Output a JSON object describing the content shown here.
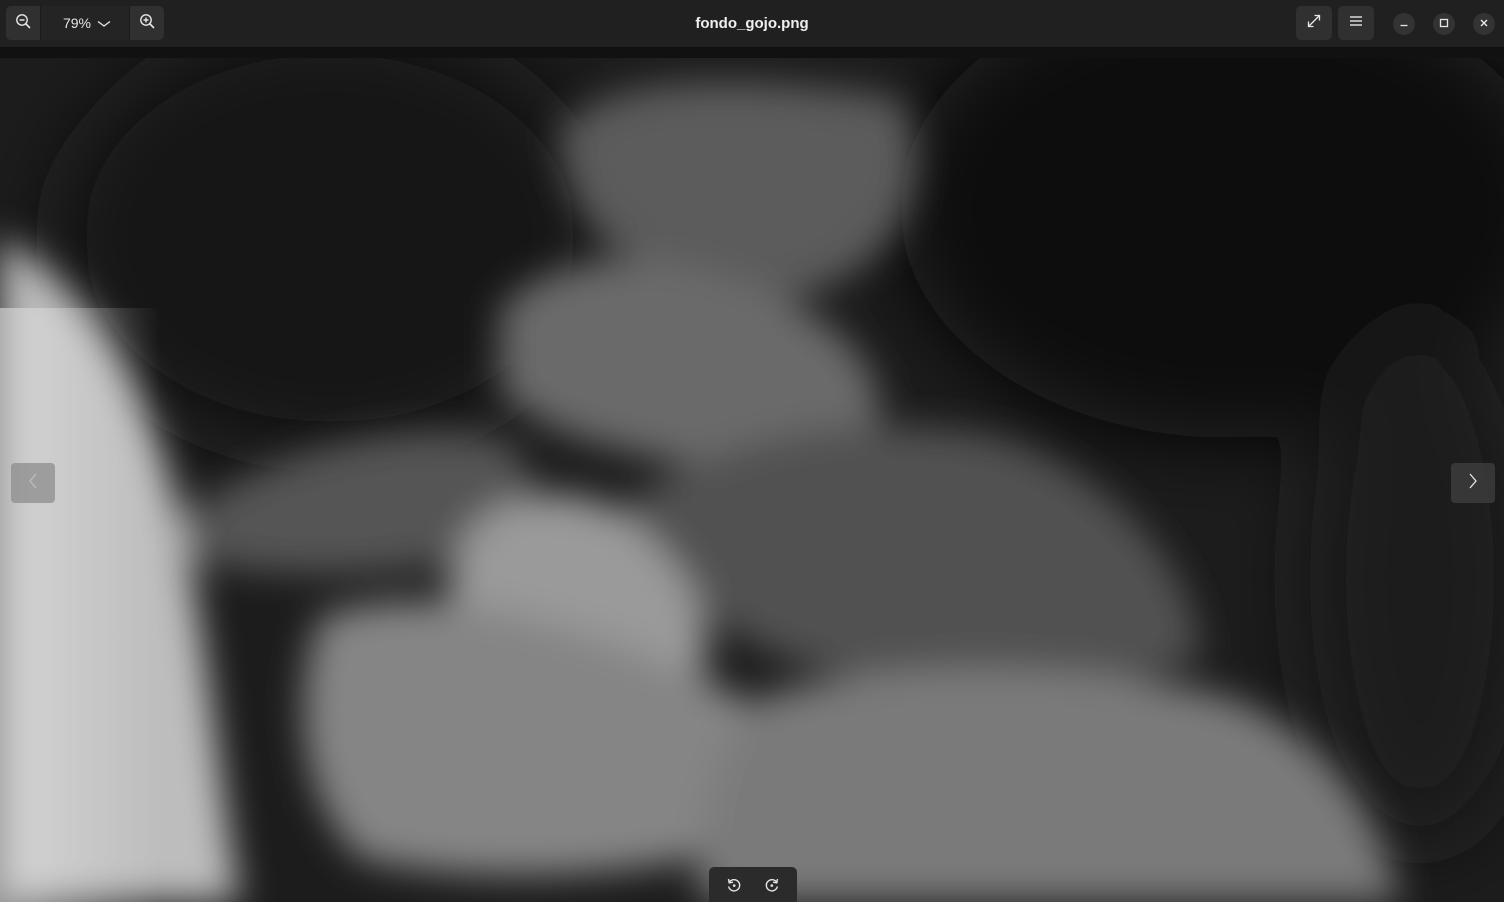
{
  "window": {
    "title": "fondo_gojo.png"
  },
  "toolbar": {
    "zoom_out_icon": "zoom-out-icon",
    "zoom_level": "79%",
    "zoom_dropdown_icon": "chevron-down-icon",
    "zoom_in_icon": "zoom-in-icon",
    "fullscreen_icon": "fullscreen-icon",
    "menu_icon": "hamburger-menu-icon"
  },
  "window_controls": {
    "minimize_icon": "minimize-icon",
    "maximize_icon": "maximize-icon",
    "close_icon": "close-icon"
  },
  "navigation": {
    "previous_icon": "chevron-left-icon",
    "next_icon": "chevron-right-icon"
  },
  "rotate_controls": {
    "rotate_left_icon": "rotate-left-icon",
    "rotate_right_icon": "rotate-right-icon"
  },
  "colors": {
    "header_bg": "#202020",
    "button_bg": "#303030",
    "text": "#f0f0f0"
  }
}
